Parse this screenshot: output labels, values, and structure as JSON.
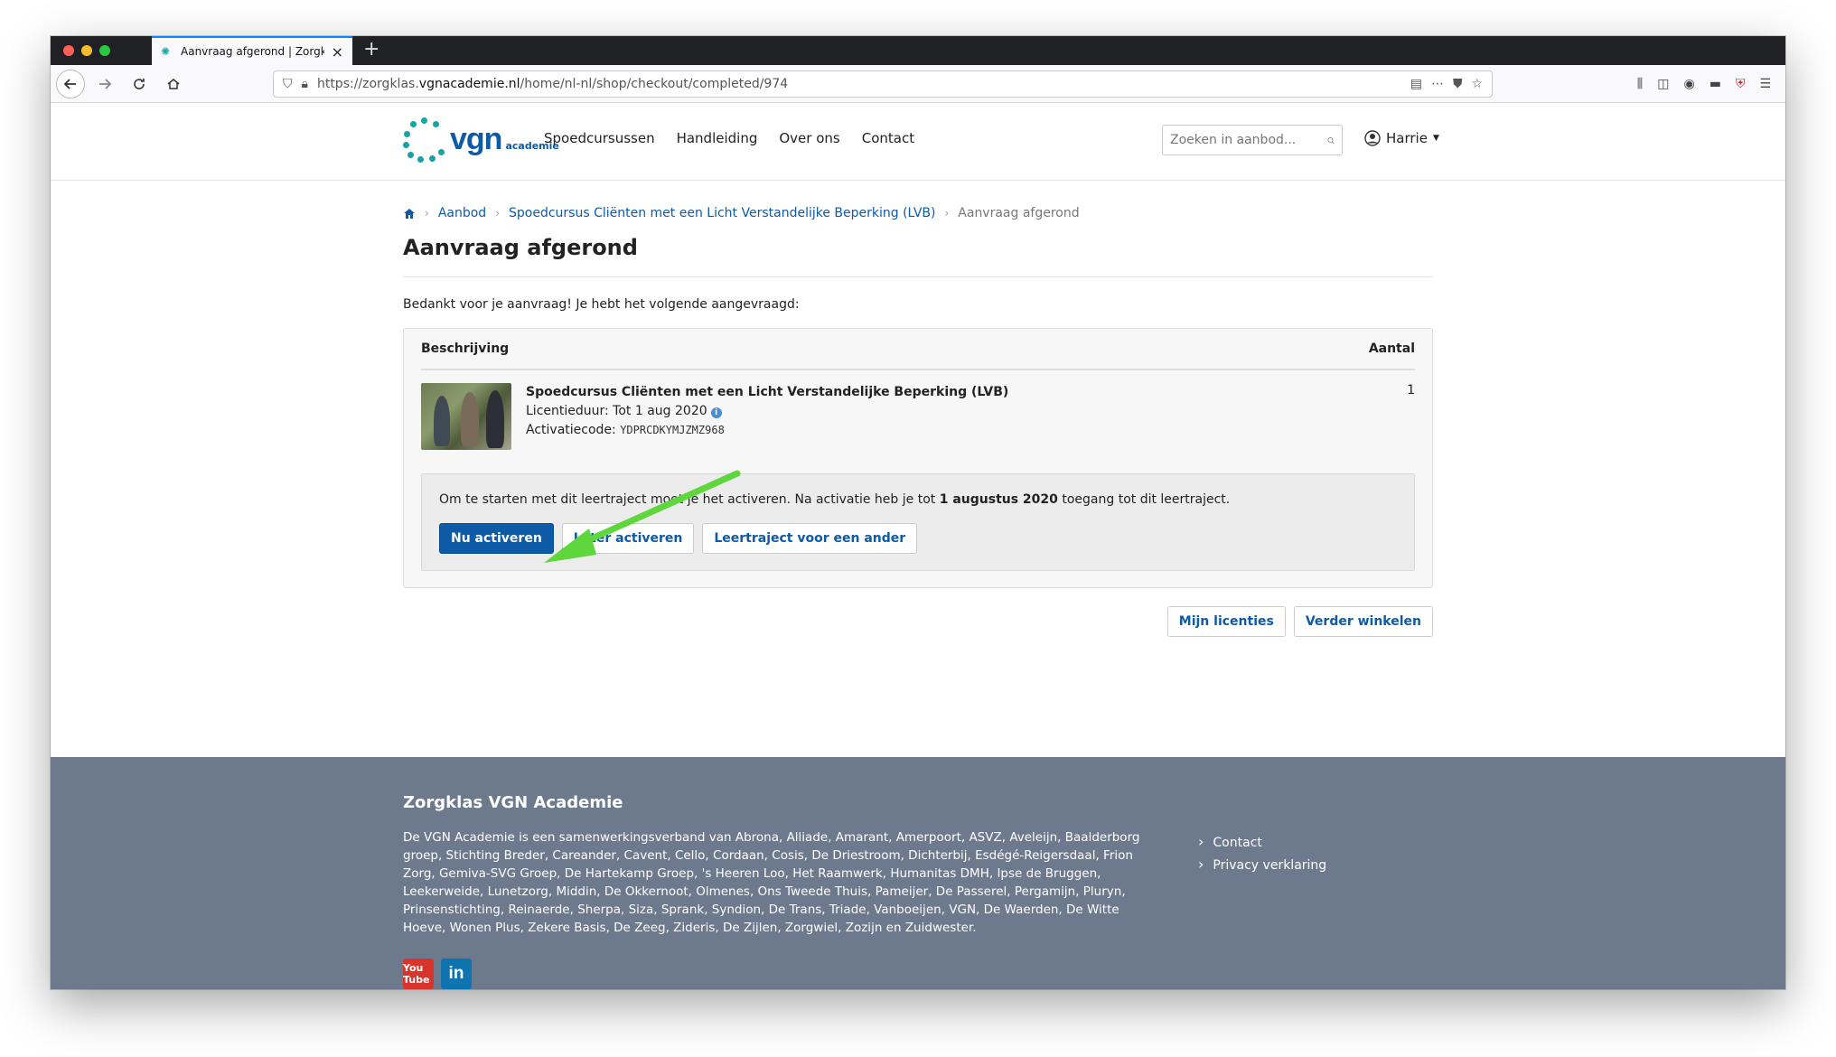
{
  "browser": {
    "tab_title": "Aanvraag afgerond | Zorgklas V",
    "new_tab": "+",
    "url_prefix": "https://zorgklas.",
    "url_domain": "vgnacademie.nl",
    "url_path": "/home/nl-nl/shop/checkout/completed/974"
  },
  "site": {
    "logo_text": "vgn",
    "logo_sub": "academie",
    "nav": [
      "Spoedcursussen",
      "Handleiding",
      "Over ons",
      "Contact"
    ],
    "search_placeholder": "Zoeken in aanbod...",
    "user": "Harrie"
  },
  "breadcrumb": {
    "items": [
      "Aanbod",
      "Spoedcursus Cliënten met een Licht Verstandelijke Beperking (LVB)"
    ],
    "current": "Aanvraag afgerond"
  },
  "page": {
    "title": "Aanvraag afgerond",
    "intro": "Bedankt voor je aanvraag! Je hebt het volgende aangevraagd:"
  },
  "order": {
    "col_description": "Beschrijving",
    "col_amount": "Aantal",
    "item": {
      "name": "Spoedcursus Cliënten met een Licht Verstandelijke Beperking (LVB)",
      "license_label": "Licentieduur: Tot 1 aug 2020",
      "code_label": "Activatiecode:",
      "code": "YDPRCDKYMJZMZ968",
      "qty": "1"
    },
    "activation": {
      "msg_start": "Om te starten met dit leertraject moet je het activeren. Na activatie heb je tot ",
      "msg_date": "1 augustus 2020",
      "msg_end": " toegang tot dit leertraject.",
      "btn_now": "Nu activeren",
      "btn_later": "Later activeren",
      "btn_other": "Leertraject voor een ander"
    },
    "btn_licenses": "Mijn licenties",
    "btn_continue": "Verder winkelen"
  },
  "footer": {
    "title": "Zorgklas VGN Academie",
    "text": "De VGN Academie is een samenwerkingsverband van Abrona, Alliade, Amarant, Amerpoort, ASVZ, Aveleijn, Baalderborg groep, Stichting Breder, Careander, Cavent, Cello, Cordaan, Cosis, De Driestroom, Dichterbij, Esdégé-Reigersdaal, Frion Zorg, Gemiva-SVG Groep, De Hartekamp Groep, 's Heeren Loo, Het Raamwerk, Humanitas DMH, Ipse de Bruggen, Leekerweide, Lunetzorg, Middin, De Okkernoot, Olmenes, Ons Tweede Thuis, Pameijer, De Passerel, Pergamijn, Pluryn, Prinsenstichting, Reinaerde, Sherpa, Siza, Sprank, Syndion, De Trans, Triade, Vanboeijen, VGN, De Waerden, De Witte Hoeve, Wonen Plus, Zekere Basis, De Zeeg, Zideris, De Zijlen, Zorgwiel, Zozijn en Zuidwester.",
    "links": [
      "Contact",
      "Privacy verklaring"
    ],
    "social_youtube": "You Tube",
    "social_linkedin": "in"
  },
  "colors": {
    "brand_blue": "#0d5aa7",
    "footer_bg": "#6d7a8e",
    "arrow_green": "#5fd63b"
  }
}
